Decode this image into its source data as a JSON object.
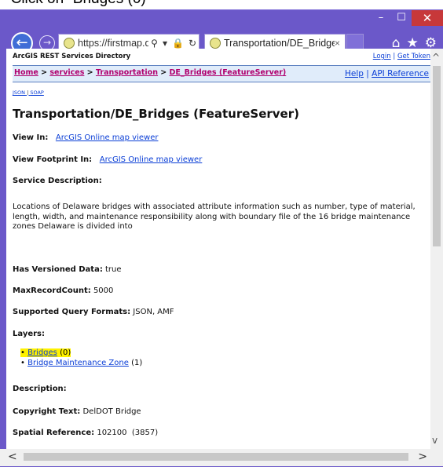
{
  "caption": "- Click on “Bridges (0)”",
  "window_controls": {
    "minimize": "–",
    "maximize": "☐",
    "close": "✕"
  },
  "browser": {
    "address": "https://firstmap.d...",
    "tab_title": "Transportation/DE_Bridges ...",
    "tab_close": "×",
    "tools": [
      "⌂",
      "★",
      "⚙"
    ]
  },
  "page": {
    "header_title": "ArcGIS REST Services Directory",
    "login": "Login",
    "login_sep": " | ",
    "get_token": "Get Token",
    "breadcrumbs": [
      "Home",
      "services",
      "Transportation",
      "DE_Bridges (FeatureServer)"
    ],
    "crumb_sep": " > ",
    "help": "Help",
    "help_sep": " | ",
    "api_reference": "API Reference",
    "formats": [
      "JSON",
      "SOAP"
    ],
    "format_sep": " | ",
    "heading": "Transportation/DE_Bridges (FeatureServer)",
    "view_in_label": "View In:",
    "view_in_link": "ArcGIS Online map viewer",
    "view_footprint_label": "View Footprint In:",
    "view_footprint_link": "ArcGIS Online map viewer",
    "service_description_label": "Service Description:",
    "service_description": "Locations of Delaware bridges with associated attribute information such as number, type of material, length, width, and maintenance responsibility along with boundary file of the 16 bridge maintenance zones Delaware is divided into",
    "has_versioned_label": "Has Versioned Data:",
    "has_versioned_value": "true",
    "maxrecord_label": "MaxRecordCount:",
    "maxrecord_value": "5000",
    "query_formats_label": "Supported Query Formats:",
    "query_formats_value": "JSON, AMF",
    "layers_label": "Layers:",
    "layers": [
      {
        "name": "Bridges",
        "id": "(0)"
      },
      {
        "name": "Bridge Maintenance Zone",
        "id": "(1)"
      }
    ],
    "description_label": "Description:",
    "copyright_label": "Copyright Text:",
    "copyright_value": "DelDOT Bridge",
    "spatial_ref_label": "Spatial Reference:",
    "spatial_ref_value": "102100  (3857)"
  },
  "scroll": {
    "up": "^",
    "down": "v",
    "left": "<",
    "right": ">"
  },
  "colors": {
    "window_frame": "#6b58c9",
    "link": "#0a3ed6",
    "crumb_link": "#b0006e",
    "highlight": "#fff200"
  }
}
